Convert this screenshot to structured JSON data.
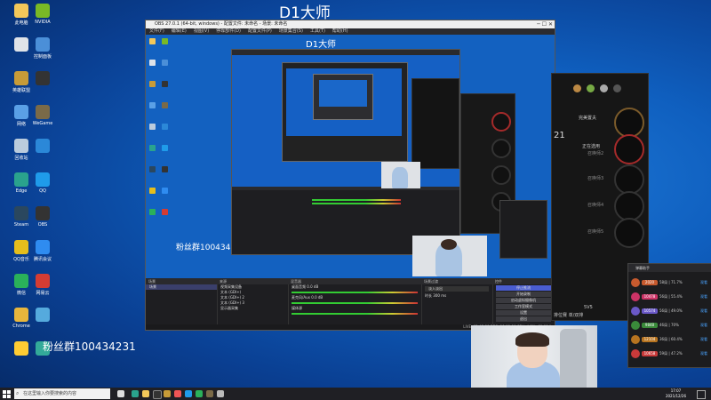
{
  "desktop": {
    "title": "D1大师",
    "fan_group_text": "粉丝群100434231",
    "icons": [
      {
        "label": "此电脑",
        "color": "#f3c85a"
      },
      {
        "label": "NVIDIA",
        "color": "#79b926"
      },
      {
        "label": "",
        "color": "#dfe3e8"
      },
      {
        "label": "控制面板",
        "color": "#4b8fd8"
      },
      {
        "label": "英雄联盟",
        "color": "#c79b38"
      },
      {
        "label": "",
        "color": "#333"
      },
      {
        "label": "网络",
        "color": "#5aa0e6"
      },
      {
        "label": "WeGame",
        "color": "#7a6a48"
      },
      {
        "label": "回收站",
        "color": "#bcd"
      },
      {
        "label": "",
        "color": "#2b88d8"
      },
      {
        "label": "Edge",
        "color": "#2aa38d"
      },
      {
        "label": "QQ",
        "color": "#1f9bea"
      },
      {
        "label": "Steam",
        "color": "#2a475e"
      },
      {
        "label": "OBS",
        "color": "#333"
      },
      {
        "label": "QQ音乐",
        "color": "#e5be1c"
      },
      {
        "label": "腾讯会议",
        "color": "#2f8cf0"
      },
      {
        "label": "微信",
        "color": "#2ab15a"
      },
      {
        "label": "网易云",
        "color": "#d43c33"
      },
      {
        "label": "Chrome",
        "color": "#e8b63c"
      },
      {
        "label": "",
        "color": "#55aadd"
      },
      {
        "label": "",
        "color": "#ffcc33"
      },
      {
        "label": "",
        "color": "#3a9"
      }
    ]
  },
  "obs": {
    "window_title": "OBS 27.0.1 (64-bit, windows) - 配置文件: 未命名 - 场景: 未命名",
    "menu": [
      "文件(F)",
      "编辑(E)",
      "视图(V)",
      "停靠部件(D)",
      "配置文件(P)",
      "场景集合(S)",
      "工具(T)",
      "帮助(H)"
    ],
    "preview_title": "D1大师",
    "preview_fans": "粉丝群100434231",
    "docks": {
      "scenes": {
        "header": "场景",
        "items": [
          "场景"
        ]
      },
      "sources": {
        "header": "来源",
        "items": [
          "视频采集设备",
          "文本 (GDI+)",
          "文本 (GDI+) 2",
          "文本 (GDI+) 3",
          "显示器采集"
        ]
      },
      "mixer": {
        "header": "混音器",
        "items": [
          "桌面音频 0.0 dB",
          "麦克风/Aux 0.0 dB",
          "媒体源"
        ]
      },
      "transitions": {
        "header": "场景过渡",
        "mode": "淡入淡出",
        "duration_label": "时长",
        "duration": "300 ms"
      },
      "controls": {
        "header": "控件",
        "buttons": [
          "停止推流",
          "开始录制",
          "启动虚拟摄像机",
          "工作室模式",
          "设置",
          "退出"
        ]
      }
    },
    "status": "LIVE: 02:43:00   REC: 00:00:00   CPU: 4.3%, 60.00 fps"
  },
  "game": {
    "labels": [
      "完美置夫",
      "正在选用",
      "召唤师2",
      "召唤师3",
      "召唤师4",
      "召唤师5"
    ],
    "rank_text": "排位赛 单/双排",
    "side_text": "5V5",
    "left_num": "21"
  },
  "chat": {
    "title": "弹幕助手",
    "rows": [
      {
        "badge": "2020",
        "text": "58局 | 71.7%",
        "color": "#c75a2e",
        "action": "观看"
      },
      {
        "badge": "10478",
        "text": "56局 | 55.4%",
        "color": "#cc3366",
        "action": "观看"
      },
      {
        "badge": "10574",
        "text": "56局 | 49.0%",
        "color": "#6a58c7",
        "action": "观看"
      },
      {
        "badge": "9848",
        "text": "46局 | 70%",
        "color": "#3a8a3a",
        "action": "观看"
      },
      {
        "badge": "12104",
        "text": "36局 | 60.4%",
        "color": "#b87420",
        "action": "观看"
      },
      {
        "badge": "10658",
        "text": "59局 | 47.2%",
        "color": "#c93a3a",
        "action": "观看"
      }
    ]
  },
  "taskbar": {
    "search_placeholder": "在这里输入你要搜索的内容",
    "time": "17:07",
    "date": "2021/12/26"
  }
}
